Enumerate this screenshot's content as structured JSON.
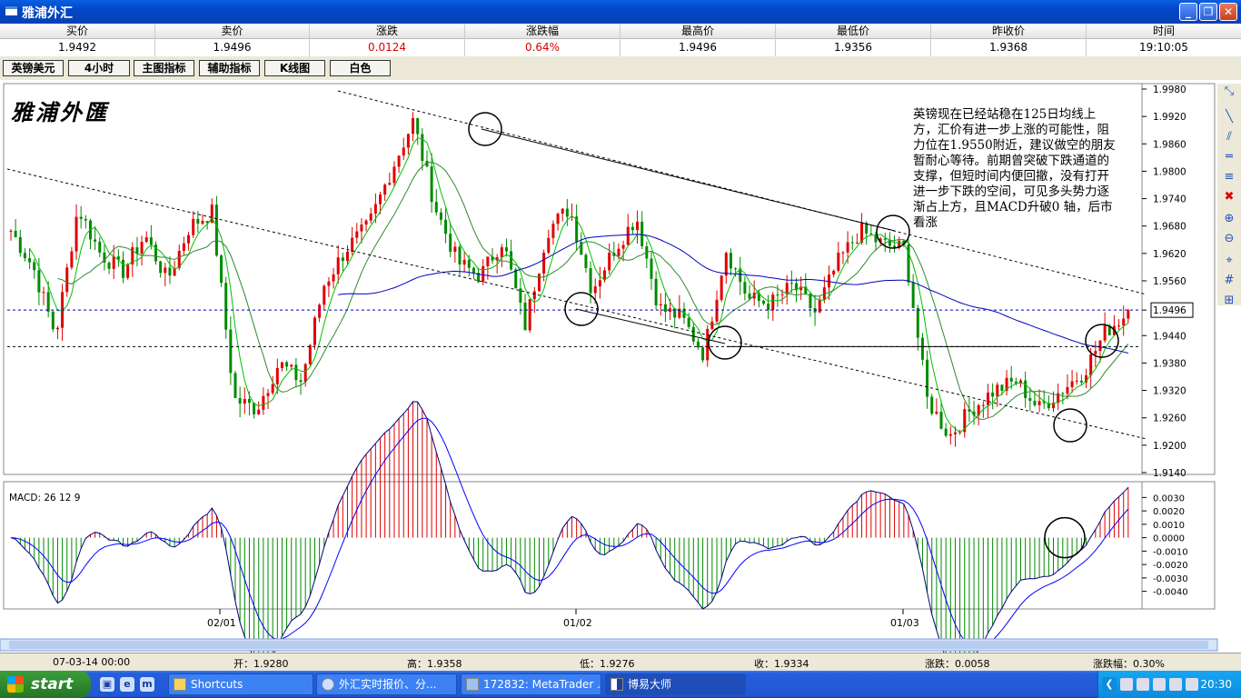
{
  "window": {
    "title": "雅浦外汇"
  },
  "quotes": {
    "headers": [
      "买价",
      "卖价",
      "涨跌",
      "涨跌幅",
      "最高价",
      "最低价",
      "昨收价",
      "时间"
    ],
    "values": [
      "1.9492",
      "1.9496",
      "0.0124",
      "0.64%",
      "1.9496",
      "1.9356",
      "1.9368",
      "19:10:05"
    ]
  },
  "toolbar": {
    "buttons": [
      "英镑美元",
      "4小时",
      "主图指标",
      "辅助指标",
      "K线图",
      "白色"
    ]
  },
  "chart": {
    "logo": "雅浦外匯",
    "annotation": "英镑现在已经站稳在125日均线上方，汇价有进一步上涨的可能性，阻力位在1.9550附近，建议做空的朋友暂耐心等待。前期曾突破下跌通道的支撑，但短时间内便回撤，没有打开进一步下跌的空间，可见多头势力逐渐占上方，且MACD升破0 轴，后市看涨",
    "current_price_label": "1.9496",
    "macd_label": "MACD: 26 12 9",
    "price_ticks": [
      "1.9980",
      "1.9920",
      "1.9860",
      "1.9800",
      "1.9740",
      "1.9680",
      "1.9620",
      "1.9560",
      "1.9496",
      "1.9440",
      "1.9380",
      "1.9320",
      "1.9260",
      "1.9200",
      "1.9140"
    ],
    "macd_ticks": [
      "0.0030",
      "0.0020",
      "0.0010",
      "0.0000",
      "-0.0010",
      "-0.0020",
      "-0.0030",
      "-0.0040"
    ],
    "date_ticks": [
      "02/01",
      "01/02",
      "01/03"
    ],
    "colors": {
      "up": "#E00000",
      "down": "#008A00",
      "ma_short": "#00C000",
      "ma_long": "#0000C0",
      "macd_line": "#000080"
    }
  },
  "chart_data": {
    "type": "candlestick",
    "symbol": "英镑美元",
    "timeframe": "4小时",
    "ylim": [
      1.914,
      1.998
    ],
    "x_ticks": [
      "02/01",
      "01/02",
      "01/03"
    ],
    "current_price": 1.9496,
    "support_line": 1.9416,
    "price_path": [
      1.967,
      1.959,
      1.944,
      1.972,
      1.962,
      1.958,
      1.966,
      1.956,
      1.968,
      1.971,
      1.93,
      1.928,
      1.938,
      1.934,
      1.955,
      1.963,
      1.968,
      1.98,
      1.991,
      1.972,
      1.96,
      1.957,
      1.965,
      1.946,
      1.967,
      1.972,
      1.954,
      1.963,
      1.97,
      1.95,
      1.948,
      1.94,
      1.963,
      1.952,
      1.951,
      1.955,
      1.949,
      1.96,
      1.967,
      1.964,
      1.963,
      1.93,
      1.922,
      1.928,
      1.932,
      1.934,
      1.928,
      1.932,
      1.936,
      1.945,
      1.949
    ],
    "macd": {
      "label": "MACD: 26 12 9",
      "ylim": [
        -0.0045,
        0.0035
      ]
    }
  },
  "status": {
    "date": "07-03-14 00:00",
    "open": "开：1.9280",
    "high": "高：1.9358",
    "low": "低：1.9276",
    "close": "收：1.9334",
    "change": "涨跌：0.0058",
    "change_pct": "涨跌幅：0.30%"
  },
  "taskbar": {
    "start": "start",
    "tasks": [
      "Shortcuts",
      "外汇实时报价、分...",
      "172832: MetaTrader ...",
      "博易大师"
    ],
    "clock": "20:30"
  }
}
